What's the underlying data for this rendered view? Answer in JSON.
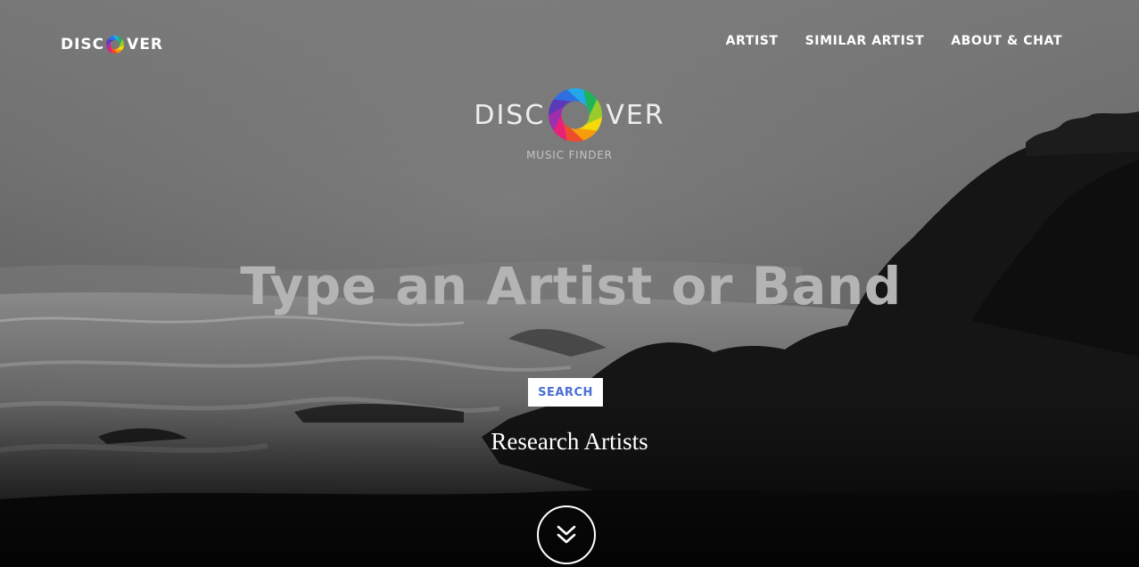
{
  "brand": {
    "text_before": "DISC",
    "text_after": "VER",
    "icon": "color-ring-logo-icon"
  },
  "nav": {
    "items": [
      {
        "label": "ARTIST"
      },
      {
        "label": "SIMILAR ARTIST"
      },
      {
        "label": "ABOUT & CHAT"
      }
    ]
  },
  "hero": {
    "logo": {
      "text_before": "DISC",
      "text_after": "VER",
      "icon": "color-ring-logo-icon"
    },
    "tagline": "MUSIC FINDER",
    "search": {
      "placeholder": "Type an Artist or Band",
      "value": ""
    },
    "search_button": "SEARCH",
    "subtitle": "Research Artists",
    "scroll_icon": "double-chevron-down-icon"
  },
  "colors": {
    "search_button_text": "#4a6fd6",
    "ring": [
      "#f5d90a",
      "#f59d0a",
      "#ef4b2d",
      "#e8207a",
      "#9b2fae",
      "#5a3ab8",
      "#2f6fe0",
      "#22a9e8",
      "#1fb35a",
      "#9acb2c"
    ]
  }
}
